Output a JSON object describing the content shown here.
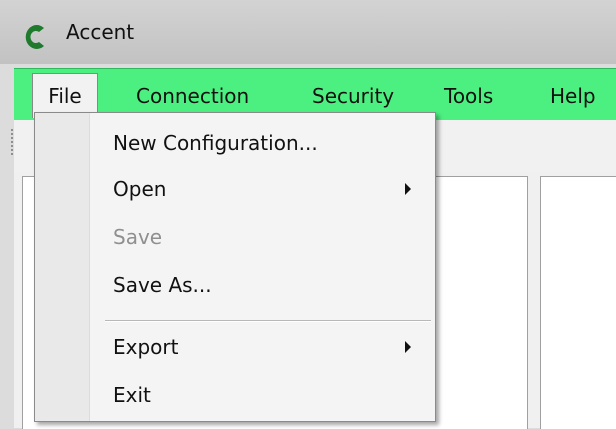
{
  "window": {
    "title": "Accent",
    "icon": "accent-c-logo-icon",
    "accent_color": "#1f7a2e"
  },
  "menubar": {
    "color": "#4cf080",
    "items": [
      {
        "label": "File"
      },
      {
        "label": "Connection"
      },
      {
        "label": "Security"
      },
      {
        "label": "Tools"
      },
      {
        "label": "Help"
      }
    ]
  },
  "file_menu": {
    "items": [
      {
        "label": "New Configuration...",
        "enabled": true
      },
      {
        "label": "Open",
        "enabled": true,
        "submenu": true
      },
      {
        "label": "Save",
        "enabled": false
      },
      {
        "label": "Save As...",
        "enabled": true
      },
      {
        "label": "Export",
        "enabled": true,
        "submenu": true
      },
      {
        "label": "Exit",
        "enabled": true
      }
    ]
  }
}
